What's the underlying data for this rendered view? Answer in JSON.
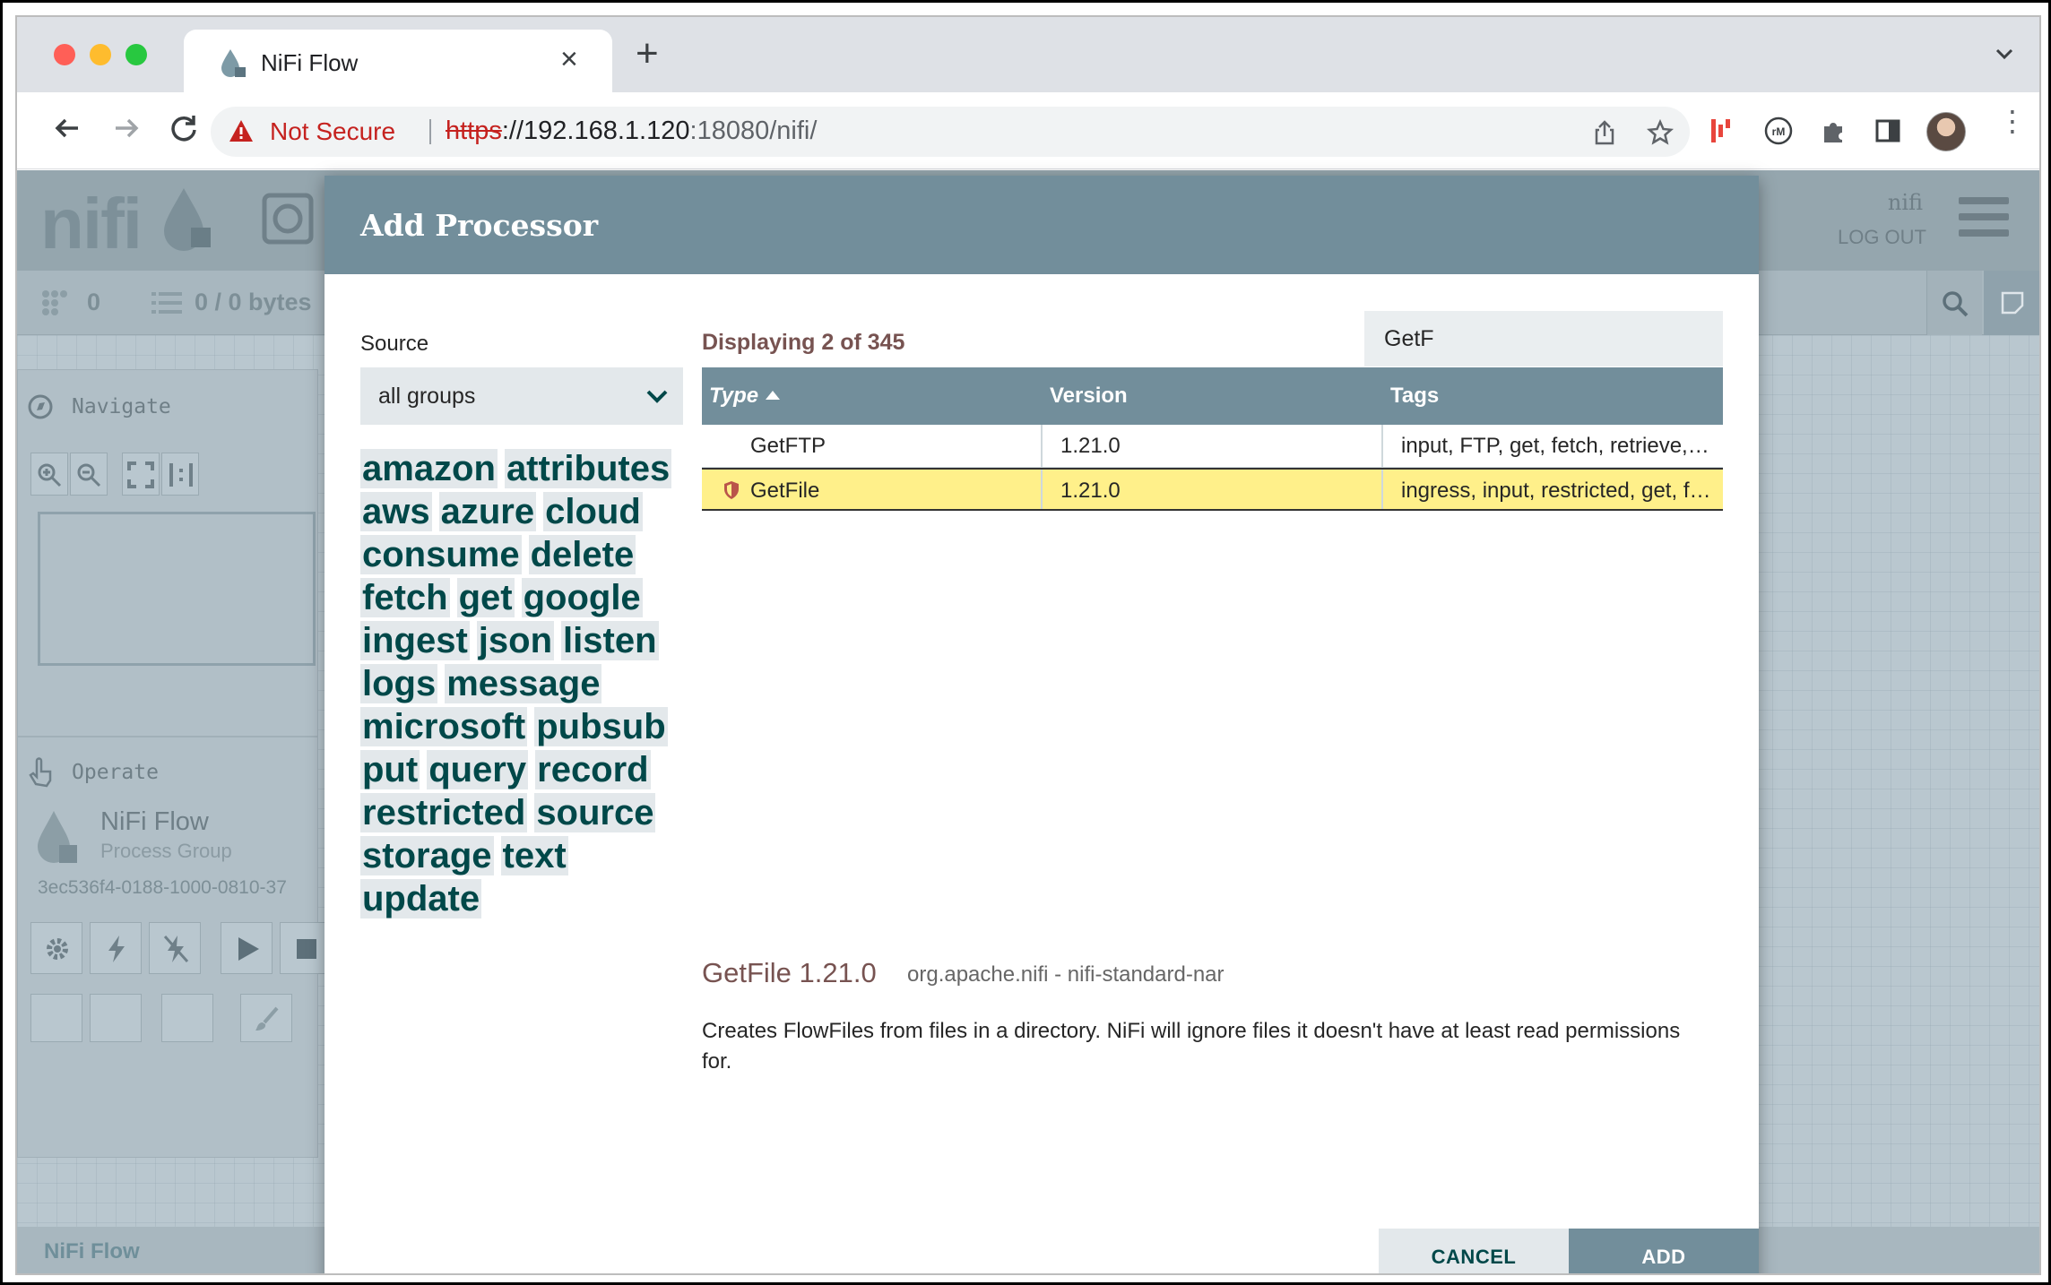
{
  "browser": {
    "tab_title": "NiFi Flow",
    "security_label": "Not Secure",
    "url_scheme": "https",
    "url_host": "://192.168.1.120",
    "url_rest": ":18080/nifi/"
  },
  "app": {
    "user": "nifi",
    "logout": "LOG OUT",
    "stat_components": "0",
    "stat_queued": "0 / 0 bytes",
    "navigate_title": "Navigate",
    "operate_title": "Operate",
    "group_name": "NiFi Flow",
    "group_type": "Process Group",
    "group_id": "3ec536f4-0188-1000-0810-37",
    "breadcrumb": "NiFi Flow"
  },
  "dialog": {
    "title": "Add Processor",
    "source_label": "Source",
    "source_value": "all groups",
    "displaying": "Displaying 2 of 345",
    "filter_value": "GetF",
    "columns": [
      "Type",
      "Version",
      "Tags"
    ],
    "rows": [
      {
        "type": "GetFTP",
        "version": "1.21.0",
        "tags": "input, FTP, get, fetch, retrieve, fil...",
        "restricted": false,
        "selected": false
      },
      {
        "type": "GetFile",
        "version": "1.21.0",
        "tags": "ingress, input, restricted, get, fil...",
        "restricted": true,
        "selected": true
      }
    ],
    "tags": [
      "amazon",
      "attributes",
      "aws",
      "azure",
      "cloud",
      "consume",
      "delete",
      "fetch",
      "get",
      "google",
      "ingest",
      "json",
      "listen",
      "logs",
      "message",
      "microsoft",
      "pubsub",
      "put",
      "query",
      "record",
      "restricted",
      "source",
      "storage",
      "text",
      "update"
    ],
    "detail_title": "GetFile 1.21.0",
    "detail_bundle": "org.apache.nifi - nifi-standard-nar",
    "detail_description": "Creates FlowFiles from files in a directory. NiFi will ignore files it doesn't have at least read permissions for.",
    "cancel_label": "CANCEL",
    "add_label": "ADD"
  },
  "colors": {
    "header": "#728e9b",
    "tag_text": "#004849",
    "selected_row": "#fff08a",
    "accent_text": "#775351"
  }
}
